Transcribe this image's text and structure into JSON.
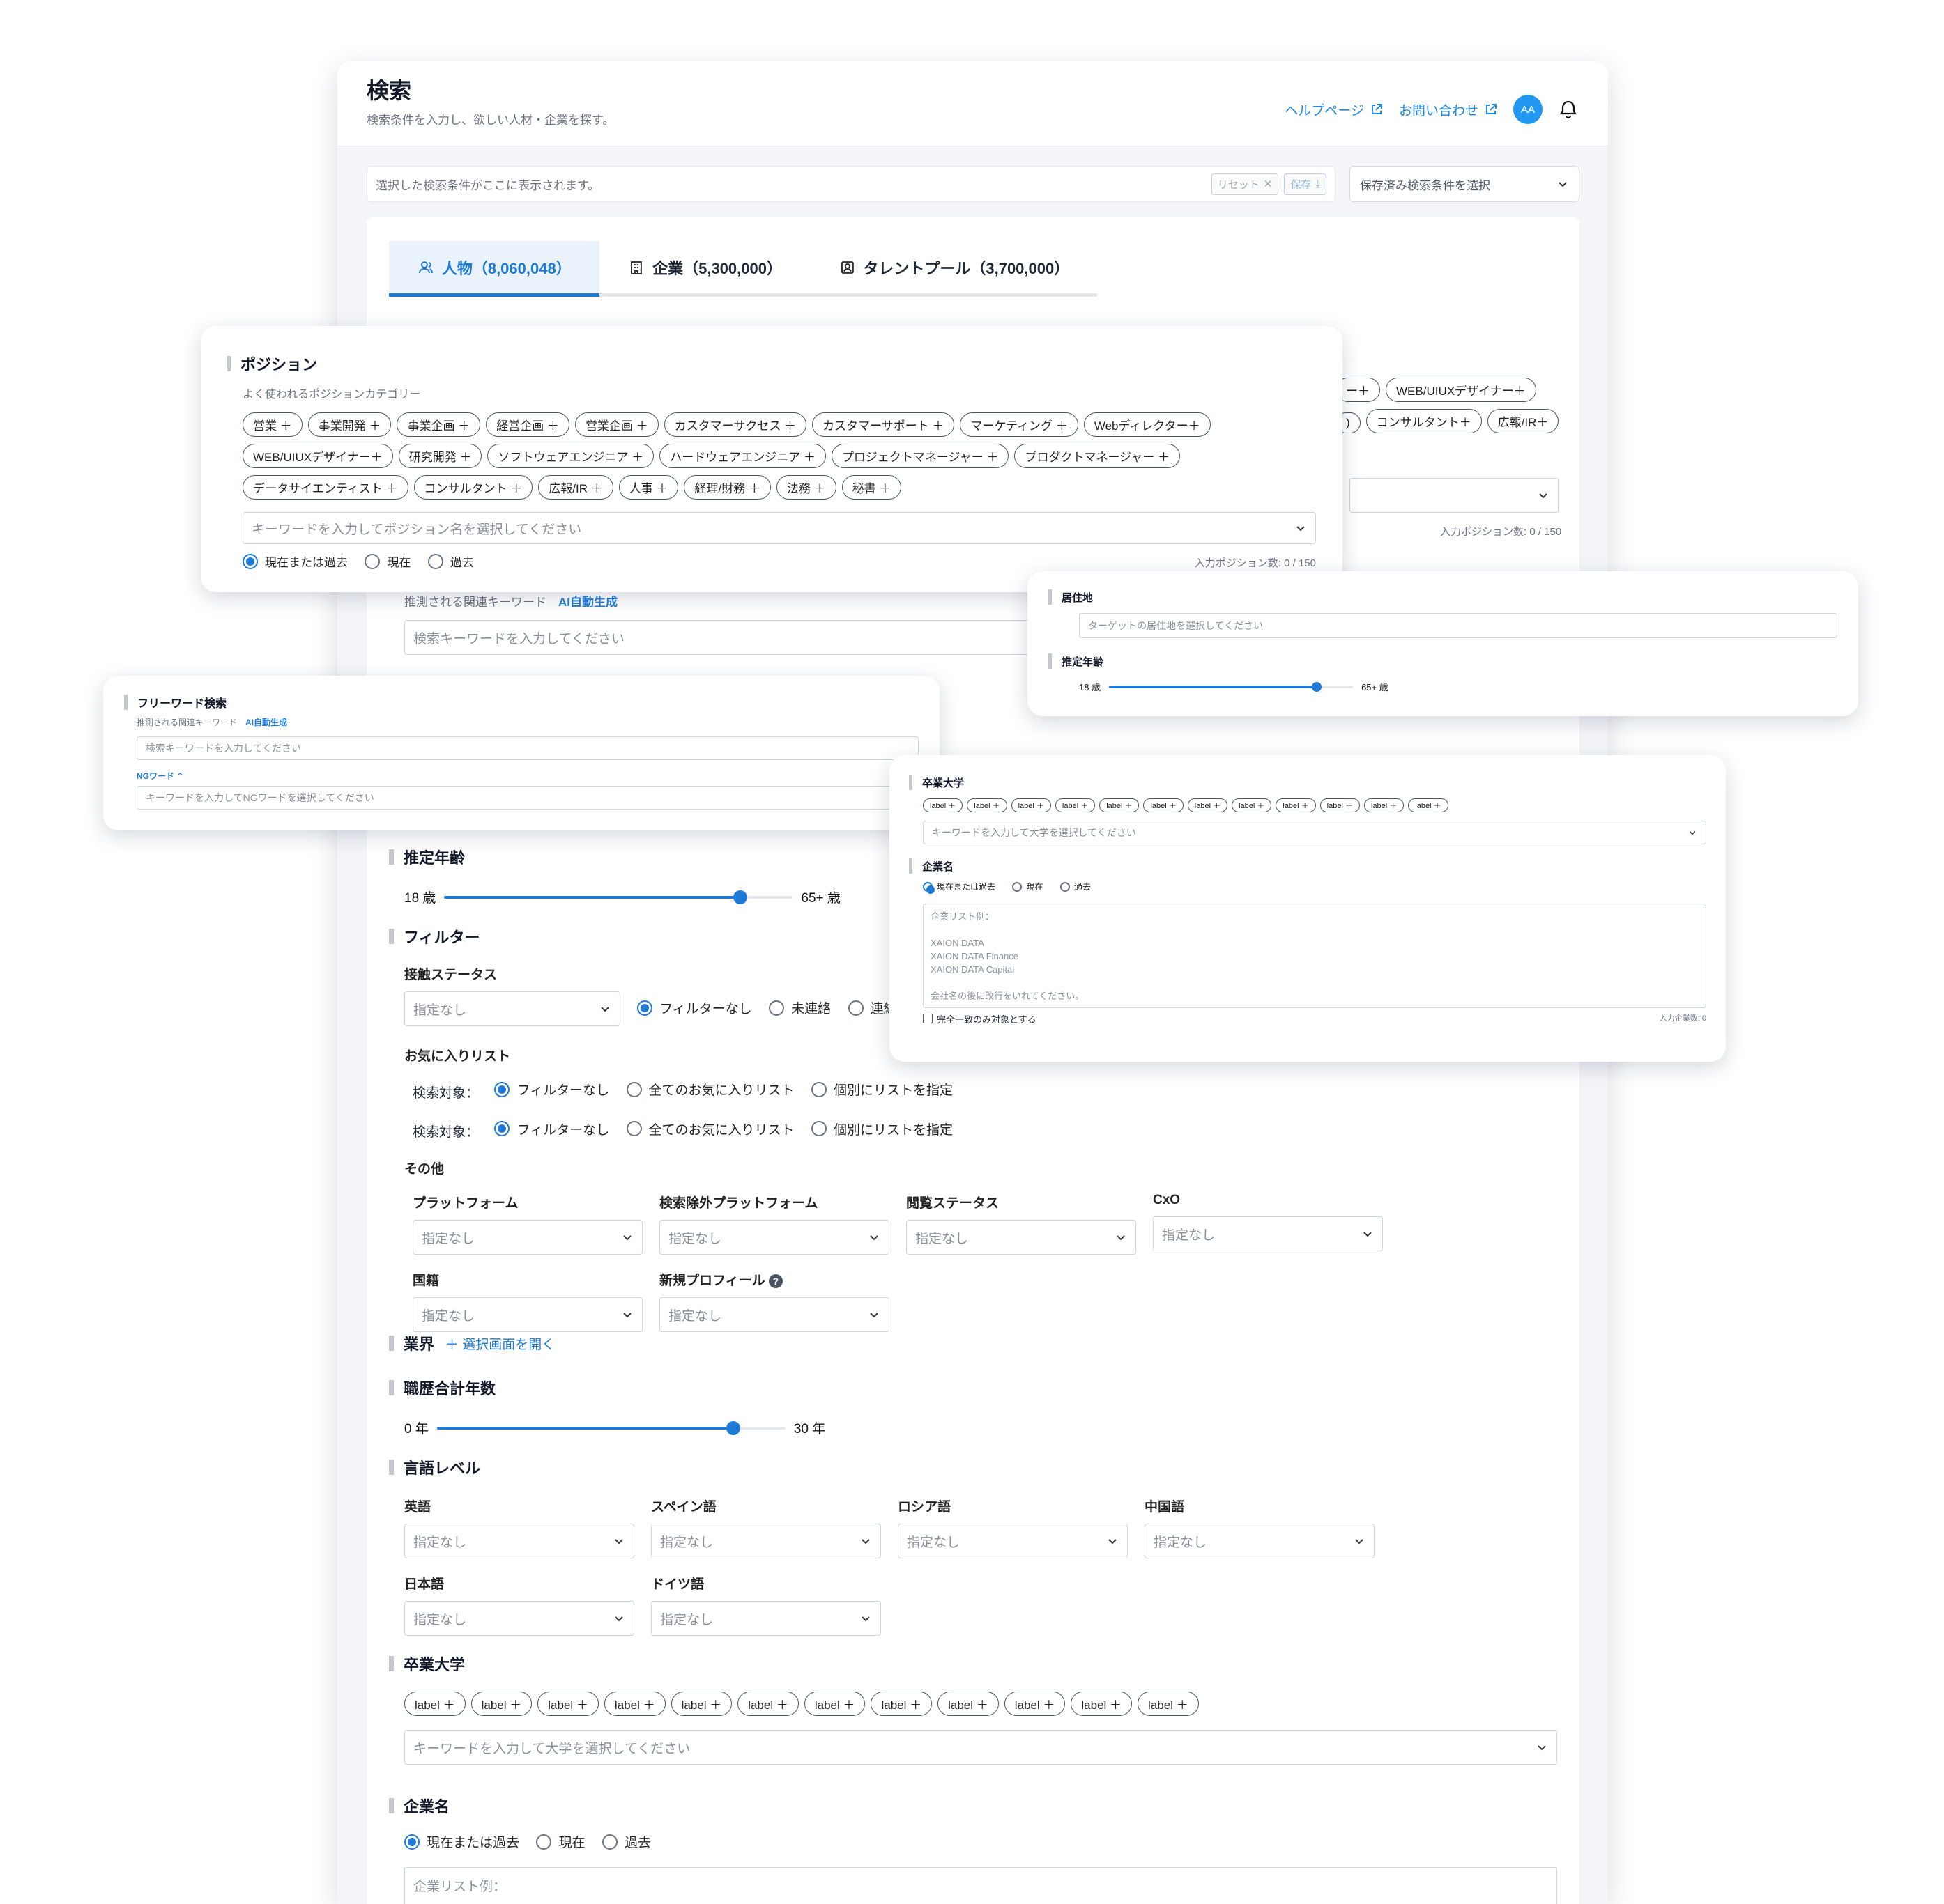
{
  "header": {
    "title": "検索",
    "subtitle": "検索条件を入力し、欲しい人材・企業を探す。",
    "help_link": "ヘルプページ",
    "contact_link": "お問い合わせ",
    "avatar_initials": "AA"
  },
  "condition_bar": {
    "placeholder": "選択した検索条件がここに表示されます。",
    "reset_label": "リセット",
    "save_label": "保存",
    "saved_select": "保存済み検索条件を選択"
  },
  "tabs": [
    {
      "label": "人物（8,060,048）",
      "icon": "person-icon"
    },
    {
      "label": "企業（5,300,000）",
      "icon": "building-icon"
    },
    {
      "label": "タレントプール（3,700,000）",
      "icon": "pool-icon"
    }
  ],
  "main": {
    "bg_chips_row1": [
      "ー＋",
      "WEB/UIUXデザイナー＋"
    ],
    "bg_chips_row2": [
      ")",
      "コンサルタント＋",
      "広報/IR＋"
    ],
    "bg_position_count": "入力ポジション数: 0 / 150",
    "bg_keyword_hint": "推測される関連キーワード",
    "bg_ai": "AI自動生成",
    "bg_keyword_input": "検索キーワードを入力してください",
    "age": {
      "title": "推定年齢",
      "min": "18 歳",
      "max": "65+ 歳",
      "level": 0.85
    },
    "filter": {
      "title": "フィルター",
      "contact_status": "接触ステータス",
      "contact_select": "指定なし",
      "contact_radios": [
        "フィルターなし",
        "未連絡",
        "連絡"
      ],
      "favorites": "お気に入りリスト",
      "search_target": "検索対象：",
      "fav_radios": [
        "フィルターなし",
        "全てのお気に入りリスト",
        "個別にリストを指定"
      ],
      "other": "その他",
      "other_fields": [
        {
          "label": "プラットフォーム",
          "value": "指定なし"
        },
        {
          "label": "検索除外プラットフォーム",
          "value": "指定なし"
        },
        {
          "label": "閲覧ステータス",
          "value": "指定なし"
        },
        {
          "label": "CxO",
          "value": "指定なし"
        },
        {
          "label": "国籍",
          "value": "指定なし"
        },
        {
          "label": "新規プロフィール",
          "value": "指定なし"
        }
      ]
    },
    "industry": {
      "title": "業界",
      "link": "＋ 選択画面を開く"
    },
    "career": {
      "title": "職歴合計年数",
      "min": "0 年",
      "max": "30 年",
      "level": 0.85
    },
    "language": {
      "title": "言語レベル",
      "fields": [
        {
          "label": "英語",
          "value": "指定なし"
        },
        {
          "label": "スペイン語",
          "value": "指定なし"
        },
        {
          "label": "ロシア語",
          "value": "指定なし"
        },
        {
          "label": "中国語",
          "value": "指定なし"
        },
        {
          "label": "日本語",
          "value": "指定なし"
        },
        {
          "label": "ドイツ語",
          "value": "指定なし"
        }
      ]
    },
    "university": {
      "title": "卒業大学",
      "chips": [
        "label ＋",
        "label ＋",
        "label ＋",
        "label ＋",
        "label ＋",
        "label ＋",
        "label ＋",
        "label ＋",
        "label ＋",
        "label ＋",
        "label ＋",
        "label ＋"
      ],
      "placeholder": "キーワードを入力して大学を選択してください"
    },
    "company": {
      "title": "企業名",
      "radios": [
        "現在または過去",
        "現在",
        "過去"
      ],
      "textarea": "企業リスト例："
    }
  },
  "position_card": {
    "title": "ポジション",
    "subtitle": "よく使われるポジションカテゴリー",
    "chips": [
      "営業 ＋",
      "事業開発 ＋",
      "事業企画 ＋",
      "経営企画 ＋",
      "営業企画 ＋",
      "カスタマーサクセス ＋",
      "カスタマーサポート ＋",
      "マーケティング ＋",
      "Webディレクター＋",
      "WEB/UIUXデザイナー＋",
      "研究開発 ＋",
      "ソフトウェアエンジニア ＋",
      "ハードウェアエンジニア ＋",
      "プロジェクトマネージャー ＋",
      "プロダクトマネージャー ＋",
      "データサイエンティスト ＋",
      "コンサルタント ＋",
      "広報/IR ＋",
      "人事 ＋",
      "経理/財務 ＋",
      "法務 ＋",
      "秘書 ＋"
    ],
    "placeholder": "キーワードを入力してポジション名を選択してください",
    "radios": [
      "現在または過去",
      "現在",
      "過去"
    ],
    "count": "入力ポジション数: 0 / 150"
  },
  "residence_card": {
    "title": "居住地",
    "placeholder": "ターゲットの居住地を選択してください",
    "age_title": "推定年齢",
    "min": "18 歳",
    "max": "65+ 歳",
    "level": 0.85
  },
  "freeword_card": {
    "title": "フリーワード検索",
    "hint": "推測される関連キーワード",
    "ai": "AI自動生成",
    "keyword_placeholder": "検索キーワードを入力してください",
    "ng_label": "NGワード",
    "ng_placeholder": "キーワードを入力してNGワードを選択してください"
  },
  "univ_card": {
    "title": "卒業大学",
    "chips": [
      "label ＋",
      "label ＋",
      "label ＋",
      "label ＋",
      "label ＋",
      "label ＋",
      "label ＋",
      "label ＋",
      "label ＋",
      "label ＋",
      "label ＋",
      "label ＋"
    ],
    "placeholder": "キーワードを入力して大学を選択してください",
    "company_title": "企業名",
    "radios": [
      "現在または過去",
      "現在",
      "過去"
    ],
    "textarea": "企業リスト例：\n\nXAION DATA\nXAION DATA Finance\nXAION DATA Capital\n\n会社名の後に改行をいれてください。",
    "exact_match": "完全一致のみ対象とする",
    "count": "入力企業数: 0"
  }
}
